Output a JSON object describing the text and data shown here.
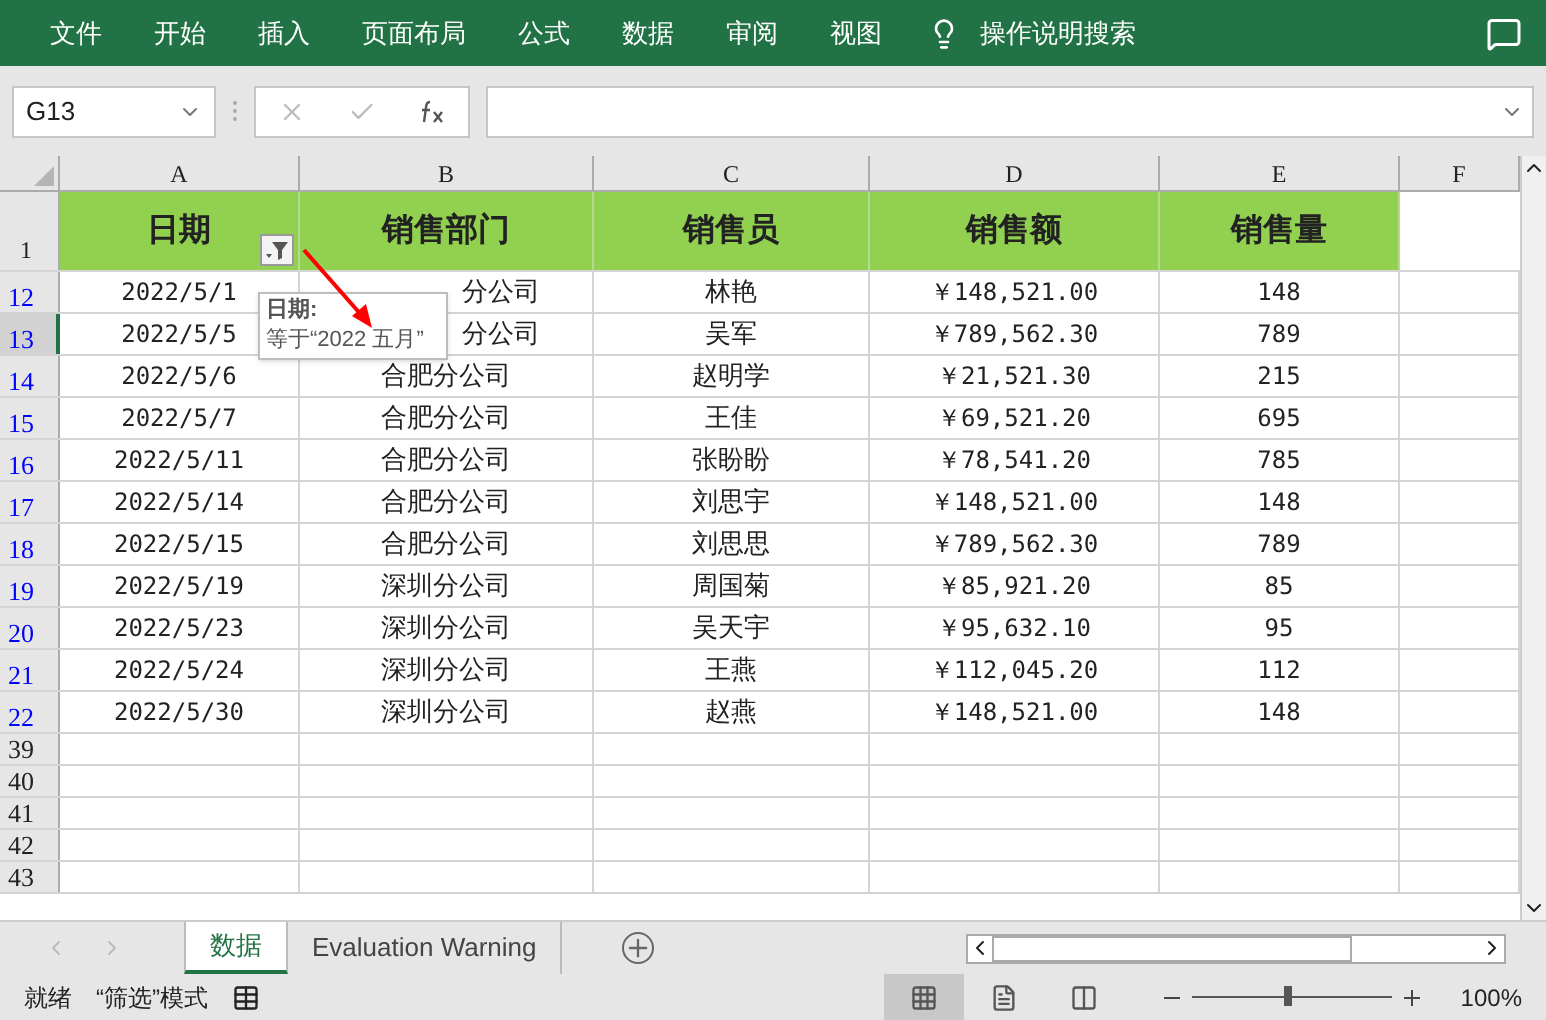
{
  "ribbon_tabs": [
    "文件",
    "开始",
    "插入",
    "页面布局",
    "公式",
    "数据",
    "审阅",
    "视图"
  ],
  "tell_me": "操作说明搜索",
  "name_box": "G13",
  "columns": [
    "A",
    "B",
    "C",
    "D",
    "E",
    "F"
  ],
  "header_row": {
    "number": "1",
    "cells": [
      {
        "text": "日期",
        "filter": true
      },
      {
        "text": "销售部门",
        "filter": false
      },
      {
        "text": "销售员",
        "filter": false
      },
      {
        "text": "销售额",
        "filter": false
      },
      {
        "text": "销售量",
        "filter": false
      }
    ]
  },
  "rows": [
    {
      "number": "12",
      "filtered": true,
      "selected": false,
      "cells": [
        "2022/5/1",
        "分公司",
        "林艳",
        "￥148,521.00",
        "148"
      ],
      "covered": true
    },
    {
      "number": "13",
      "filtered": true,
      "selected": true,
      "cells": [
        "2022/5/5",
        "分公司",
        "吴军",
        "￥789,562.30",
        "789"
      ],
      "covered": true
    },
    {
      "number": "14",
      "filtered": true,
      "selected": false,
      "cells": [
        "2022/5/6",
        "合肥分公司",
        "赵明学",
        "￥21,521.30",
        "215"
      ],
      "covered": false
    },
    {
      "number": "15",
      "filtered": true,
      "selected": false,
      "cells": [
        "2022/5/7",
        "合肥分公司",
        "王佳",
        "￥69,521.20",
        "695"
      ],
      "covered": false
    },
    {
      "number": "16",
      "filtered": true,
      "selected": false,
      "cells": [
        "2022/5/11",
        "合肥分公司",
        "张盼盼",
        "￥78,541.20",
        "785"
      ],
      "covered": false
    },
    {
      "number": "17",
      "filtered": true,
      "selected": false,
      "cells": [
        "2022/5/14",
        "合肥分公司",
        "刘思宇",
        "￥148,521.00",
        "148"
      ],
      "covered": false
    },
    {
      "number": "18",
      "filtered": true,
      "selected": false,
      "cells": [
        "2022/5/15",
        "合肥分公司",
        "刘思思",
        "￥789,562.30",
        "789"
      ],
      "covered": false
    },
    {
      "number": "19",
      "filtered": true,
      "selected": false,
      "cells": [
        "2022/5/19",
        "深圳分公司",
        "周国菊",
        "￥85,921.20",
        "85"
      ],
      "covered": false
    },
    {
      "number": "20",
      "filtered": true,
      "selected": false,
      "cells": [
        "2022/5/23",
        "深圳分公司",
        "吴天宇",
        "￥95,632.10",
        "95"
      ],
      "covered": false
    },
    {
      "number": "21",
      "filtered": true,
      "selected": false,
      "cells": [
        "2022/5/24",
        "深圳分公司",
        "王燕",
        "￥112,045.20",
        "112"
      ],
      "covered": false
    },
    {
      "number": "22",
      "filtered": true,
      "selected": false,
      "cells": [
        "2022/5/30",
        "深圳分公司",
        "赵燕",
        "￥148,521.00",
        "148"
      ],
      "covered": false
    },
    {
      "number": "39",
      "filtered": false,
      "selected": false
    },
    {
      "number": "40",
      "filtered": false,
      "selected": false
    },
    {
      "number": "41",
      "filtered": false,
      "selected": false
    },
    {
      "number": "42",
      "filtered": false,
      "selected": false
    },
    {
      "number": "43",
      "filtered": false,
      "selected": false
    }
  ],
  "tooltip": {
    "title": "日期:",
    "text": "等于“2022 五月”"
  },
  "sheet_tabs": [
    {
      "label": "数据",
      "selected": true
    },
    {
      "label": "Evaluation Warning",
      "selected": false
    }
  ],
  "status_bar": {
    "ready": "就绪",
    "mode": "“筛选”模式",
    "zoom": "100%",
    "zoom_slider": {
      "level": 0.48
    },
    "views": [
      {
        "kind": "normal",
        "selected": true
      },
      {
        "kind": "layout",
        "selected": false
      },
      {
        "kind": "pagebreak",
        "selected": false
      }
    ]
  }
}
